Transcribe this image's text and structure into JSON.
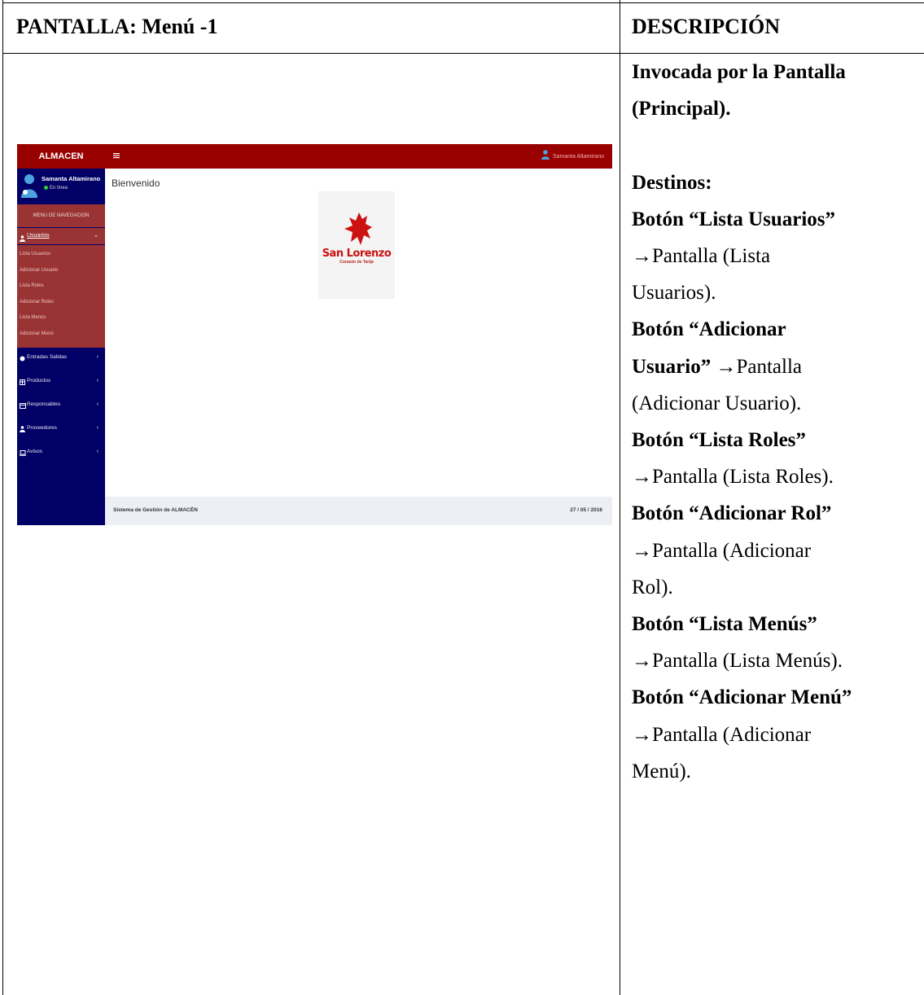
{
  "table": {
    "left_header": "PANTALLA: Menú -1",
    "right_header": "DESCRIPCIÓN"
  },
  "description": {
    "invocada_1": "Invocada por la Pantalla",
    "invocada_2": "(Principal).",
    "destinos": "Destinos:",
    "items": [
      {
        "bold_1": "Botón “Lista Usuarios”",
        "line_2": "→Pantalla (Lista",
        "line_3": "Usuarios)."
      },
      {
        "bold_1": "Botón “Adicionar",
        "bold_2": "Usuario”",
        "inline": " →Pantalla",
        "line_3": "(Adicionar Usuario)."
      },
      {
        "bold_1": "Botón “Lista Roles”",
        "line_2": "→Pantalla (Lista Roles)."
      },
      {
        "bold_1": "Botón “Adicionar Rol”",
        "line_2": "→Pantalla (Adicionar",
        "line_3": "Rol)."
      },
      {
        "bold_1": "Botón “Lista Menús”",
        "line_2": "→Pantalla (Lista Menús)."
      },
      {
        "bold_1": "Botón “Adicionar Menú”",
        "line_2": "→Pantalla (Adicionar",
        "line_3": "Menú)."
      }
    ]
  },
  "screenshot": {
    "brand": "ALMACEN",
    "menu_icon": "hamburger-icon",
    "top_user": "Samanta Altamirano",
    "profile": {
      "name": "Samanta Altamirano",
      "status": "En línea"
    },
    "nav_header": "MENU DE NAVEGACION",
    "usuarios": {
      "label": "Usuarios",
      "chevron": "⌄"
    },
    "submenu": [
      "Lista Usuarios",
      "Adicionar Usuario",
      "Lista Roles",
      "Adicionar Roles",
      "Lista Menús",
      "Adicionar Menú"
    ],
    "nav_items": [
      {
        "label": "Entradas Salidas",
        "icon": "circle-icon"
      },
      {
        "label": "Productos",
        "icon": "table-icon"
      },
      {
        "label": "Responsables",
        "icon": "card-icon"
      },
      {
        "label": "Proveedores",
        "icon": "user-icon"
      },
      {
        "label": "Avisos",
        "icon": "laptop-icon"
      }
    ],
    "chevron_left": "‹",
    "welcome": "Bienvenido",
    "logo": {
      "text": "San Lorenzo",
      "subtext": "Corazón de Tarija"
    },
    "footer_text": "Sistema de Gestión de ALMACÉN",
    "footer_date": "27 / 05 / 2016",
    "colors": {
      "topbar": "#990000",
      "sidebar": "#000066",
      "active": "#9a3434",
      "footer": "#ecf0f5"
    }
  }
}
